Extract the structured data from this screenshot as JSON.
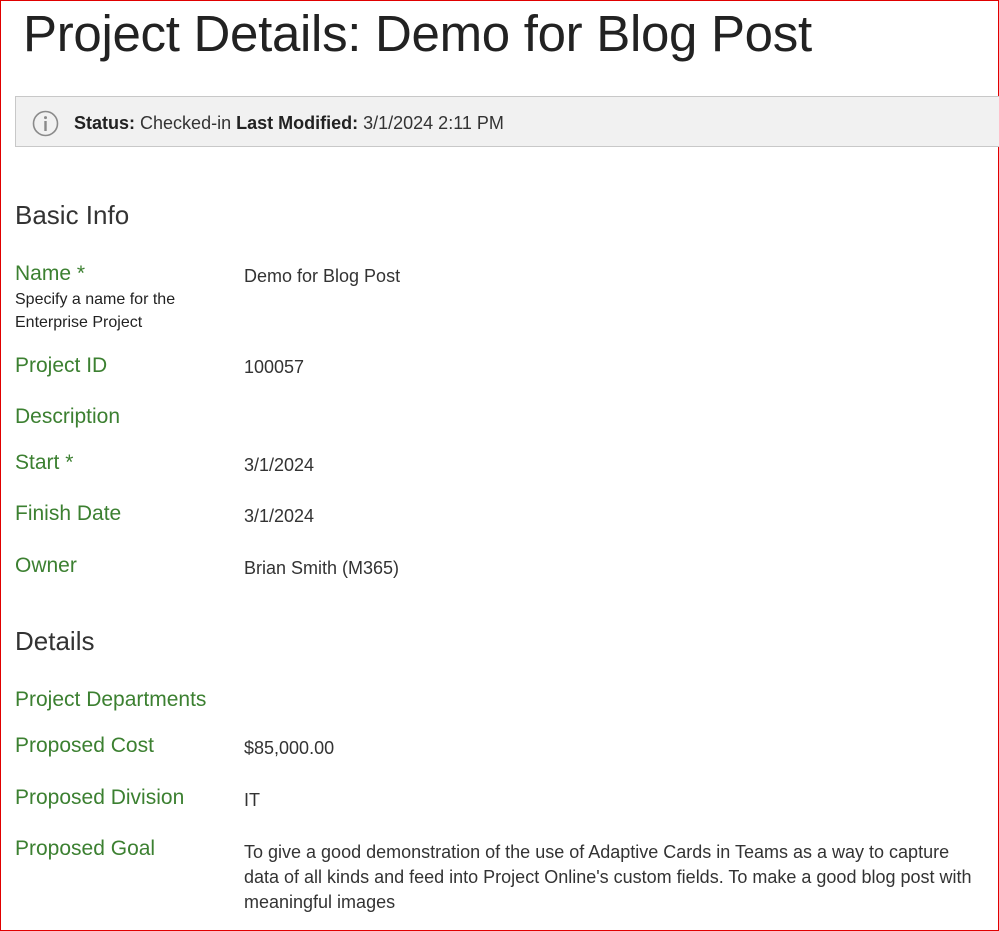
{
  "page": {
    "title": "Project Details: Demo for Blog Post"
  },
  "status": {
    "icon": "info-icon",
    "status_label": "Status:",
    "status_value": "Checked-in",
    "modified_label": "Last Modified:",
    "modified_value": "3/1/2024 2:11 PM"
  },
  "basic_info": {
    "heading": "Basic Info",
    "name": {
      "label": "Name",
      "required": "*",
      "hint": "Specify a name for the Enterprise Project",
      "value": "Demo for Blog Post"
    },
    "project_id": {
      "label": "Project ID",
      "value": "100057"
    },
    "description": {
      "label": "Description",
      "value": ""
    },
    "start": {
      "label": "Start",
      "required": "*",
      "value": "3/1/2024"
    },
    "finish_date": {
      "label": "Finish Date",
      "value": "3/1/2024"
    },
    "owner": {
      "label": "Owner",
      "value": "Brian Smith (M365)"
    }
  },
  "details": {
    "heading": "Details",
    "project_departments": {
      "label": "Project Departments",
      "value": ""
    },
    "proposed_cost": {
      "label": "Proposed Cost",
      "value": "$85,000.00"
    },
    "proposed_division": {
      "label": "Proposed Division",
      "value": "IT"
    },
    "proposed_goal": {
      "label": "Proposed Goal",
      "value": "To give a good demonstration of the use of Adaptive Cards in Teams as a way to capture data of all kinds and feed into Project Online's custom fields. To make a good blog post with meaningful images"
    }
  },
  "colors": {
    "label_green": "#3c8031",
    "frame_red": "#e00000",
    "status_bg": "#f1f1f1"
  }
}
